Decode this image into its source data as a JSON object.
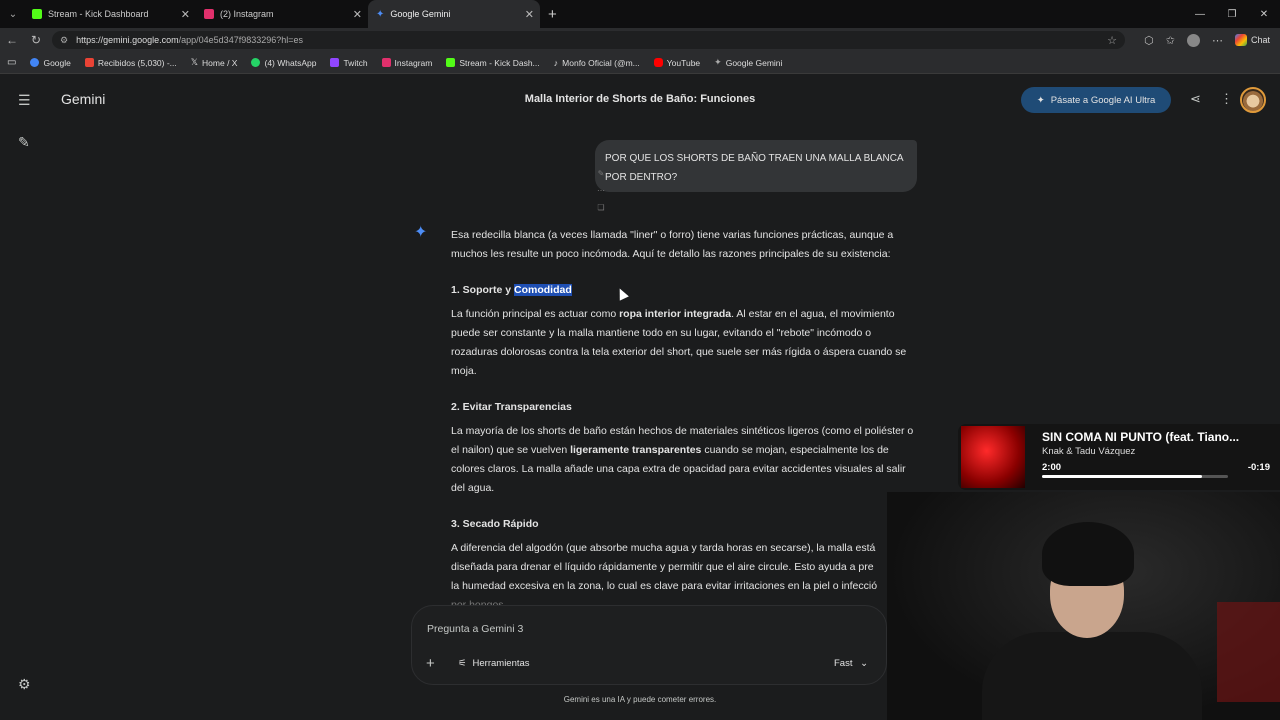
{
  "browser": {
    "tabs": [
      {
        "label": "Stream - Kick Dashboard",
        "color": "#53fc18"
      },
      {
        "label": "(2) Instagram",
        "color": "#e1306c"
      },
      {
        "label": "Google Gemini",
        "color": "#4d8df6"
      }
    ],
    "url_host": "https://gemini.google.com",
    "url_path": "/app/04e5d347f9833296?hl=es",
    "chat_label": "Chat",
    "bookmarks": [
      {
        "label": "Google",
        "color": "#4285f4"
      },
      {
        "label": "Recibidos (5,030) -...",
        "color": "#ea4335"
      },
      {
        "label": "Home / X",
        "color": "#ffffff"
      },
      {
        "label": "(4) WhatsApp",
        "color": "#25d366"
      },
      {
        "label": "Twitch",
        "color": "#9146ff"
      },
      {
        "label": "Instagram",
        "color": "#e1306c"
      },
      {
        "label": "Stream - Kick Dash...",
        "color": "#53fc18"
      },
      {
        "label": "Monfo Oficial (@m...",
        "color": "#ffffff"
      },
      {
        "label": "YouTube",
        "color": "#ff0000"
      },
      {
        "label": "Google Gemini",
        "color": "#4d8df6"
      }
    ]
  },
  "app": {
    "brand": "Gemini",
    "title": "Malla Interior de Shorts de Baño: Funciones",
    "upgrade": "Pásate a Google AI Ultra",
    "user_prompt": "POR QUE LOS SHORTS DE BAÑO TRAEN UNA MALLA BLANCA POR DENTRO?",
    "intro": "Esa redecilla blanca (a veces llamada \"liner\" o forro) tiene varias funciones prácticas, aunque a muchos les resulte un poco incómoda. Aquí te detallo las razones principales de su existencia:",
    "s1_prefix": "1. Soporte y ",
    "s1_highlight": "Comodidad",
    "s1_a": "La función principal es actuar como ",
    "s1_b": "ropa interior integrada",
    "s1_c": ". Al estar en el agua, el movimiento puede ser constante y la malla mantiene todo en su lugar, evitando el \"rebote\" incómodo o rozaduras dolorosas contra la tela exterior del short, que suele ser más rígida o áspera cuando se moja.",
    "s2_title": "2. Evitar Transparencias",
    "s2_a": "La mayoría de los shorts de baño están hechos de materiales sintéticos ligeros (como el poliéster o el nailon) que se vuelven ",
    "s2_b": "ligeramente transparentes",
    "s2_c": " cuando se mojan, especialmente los de colores claros. La malla añade una capa extra de opacidad para evitar accidentes visuales al salir del agua.",
    "s3_title": "3. Secado Rápido",
    "s3_a": "A diferencia del algodón (que absorbe mucha agua y tarda horas en secarse), la malla está diseñada para drenar el líquido rápidamente y permitir que el aire circule. Esto ayuda a pre",
    "s3_b": "la humedad excesiva en la zona, lo cual es clave para evitar irritaciones en la piel o infecció",
    "s3_c": "por hongos.",
    "input_placeholder": "Pregunta a Gemini 3",
    "tools_label": "Herramientas",
    "mode_label": "Fast",
    "disclaimer": "Gemini es una IA y puede cometer errores."
  },
  "media": {
    "title": "SIN COMA NI PUNTO (feat. Tiano...",
    "artist": "Knak & Tadu Vázquez",
    "elapsed": "2:00",
    "remaining": "-0:19",
    "progress": 0.86
  }
}
